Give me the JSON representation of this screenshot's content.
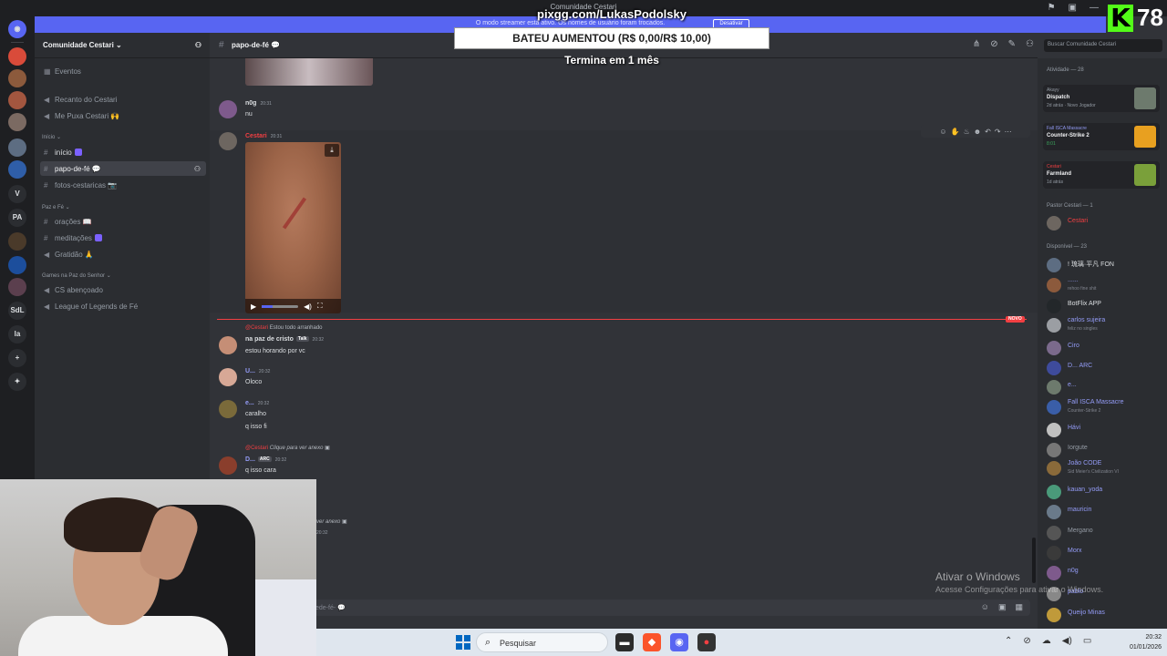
{
  "window": {
    "title": "Comunidade Cestari"
  },
  "banner": {
    "note": "O modo streamer está ativo. Os nomes de usuário foram trocados.",
    "button": "Desativar"
  },
  "stream_overlay": {
    "pix_url": "pixgg.com/LukasPodolsky",
    "goal": "BATEU AUMENTOU (R$ 0,00/R$ 10,00)",
    "ends": "Termina em 1 mês",
    "kick_letter": "K",
    "viewer_count": "78"
  },
  "server_rail": [
    "V",
    "PA",
    "SdL",
    "la"
  ],
  "guild": {
    "name": "Comunidade Cestari ⌄"
  },
  "sidebar": {
    "top": [
      {
        "label": "Eventos",
        "icon": "calendar-icon"
      },
      {
        "label": "Recanto do Cestari",
        "icon": "speaker-icon"
      },
      {
        "label": "Me Puxa Cestari 🙌",
        "icon": "speaker-icon"
      }
    ],
    "cat1": "Início ⌄",
    "cat1_items": [
      {
        "label": "início",
        "active": false
      },
      {
        "label": "papo-de-fé 💬",
        "active": true
      },
      {
        "label": "fotos-cestaricas 📷",
        "active": false
      }
    ],
    "cat2": "Paz e Fé ⌄",
    "cat2_items": [
      {
        "label": "orações 📖"
      },
      {
        "label": "meditações"
      },
      {
        "label": "Gratidão 🙏"
      }
    ],
    "cat3": "Games na Paz do Senhor ⌄",
    "cat3_items": [
      {
        "label": "CS abençoado"
      },
      {
        "label": "League of Legends de Fé"
      }
    ]
  },
  "chat": {
    "channel": "papo-de-fé 💬",
    "search_placeholder": "Buscar Comunidade Cestari",
    "messages": [
      {
        "user": "n0g",
        "time": "20:31",
        "text": "nu"
      },
      {
        "user": "Cestari",
        "time": "20:31",
        "text": ""
      },
      {
        "reply_to": "@Cestari",
        "reply_text": "Estou todo arranhado",
        "user": "na paz de cristo",
        "tag": "Talk",
        "time": "20:32",
        "text": "estou horando por vc"
      },
      {
        "user": "U...",
        "time": "20:32",
        "text": "Oloco"
      },
      {
        "user": "e...",
        "time": "20:32",
        "text": "caralho",
        "text2": "q isso fi"
      },
      {
        "reply_to": "@Cestari",
        "reply_text": "Clique para ver anexo",
        "user": "D...",
        "tag": "ARC",
        "time": "20:32",
        "text": "q isso cara"
      },
      {
        "reply_text": "ver anexo",
        "time": "20:32"
      }
    ],
    "new_label": "NOVO",
    "composer_placeholder": "ede-fé- 💬"
  },
  "members": {
    "activity_header": "Atividade — 28",
    "activities": [
      {
        "label": "Akayy",
        "name": "Dispatch",
        "sub": "2d atrás · Novo Jogador"
      },
      {
        "label": "Fall ISCA Massacre",
        "name": "Counter-Strike 2",
        "sub": "8:01"
      },
      {
        "label": "Cestari",
        "name": "Farmland",
        "sub": "1d atrás"
      }
    ],
    "pastor_header": "Pastor Cestari — 1",
    "pastor": "Cestari",
    "online_header": "Disponível — 23",
    "list": [
      {
        "name": "! 琉璃·平凡 FON",
        "sub": ""
      },
      {
        "name": "......",
        "sub": "rehoo fine shit"
      },
      {
        "name": "BotFlix APP",
        "sub": ""
      },
      {
        "name": "carlos sujeira",
        "sub": "feliz no singles"
      },
      {
        "name": "Ciro",
        "sub": ""
      },
      {
        "name": "D... ARC",
        "sub": ""
      },
      {
        "name": "e...",
        "sub": ""
      },
      {
        "name": "Fall ISCA Massacre",
        "sub": "Counter-Strike 2"
      },
      {
        "name": "Hávi",
        "sub": ""
      },
      {
        "name": "Iorgute",
        "sub": ""
      },
      {
        "name": "João CODE",
        "sub": "Sid Meier's Civilization VI"
      },
      {
        "name": "kauan_yoda",
        "sub": ""
      },
      {
        "name": "mauricin",
        "sub": ""
      },
      {
        "name": "Mergano",
        "sub": ""
      },
      {
        "name": "Morx",
        "sub": ""
      },
      {
        "name": "n0g",
        "sub": ""
      },
      {
        "name": "pablo",
        "sub": ""
      },
      {
        "name": "Queijo Minas",
        "sub": ""
      }
    ]
  },
  "watermark": {
    "line1": "Ativar o Windows",
    "line2": "Acesse Configurações para ativar o Windows."
  },
  "taskbar": {
    "search": "Pesquisar",
    "time": "20:32",
    "date": "01/01/2026"
  },
  "colors": {
    "accent": "#5865f2",
    "kick": "#53fc18",
    "new_red": "#f23f42"
  }
}
